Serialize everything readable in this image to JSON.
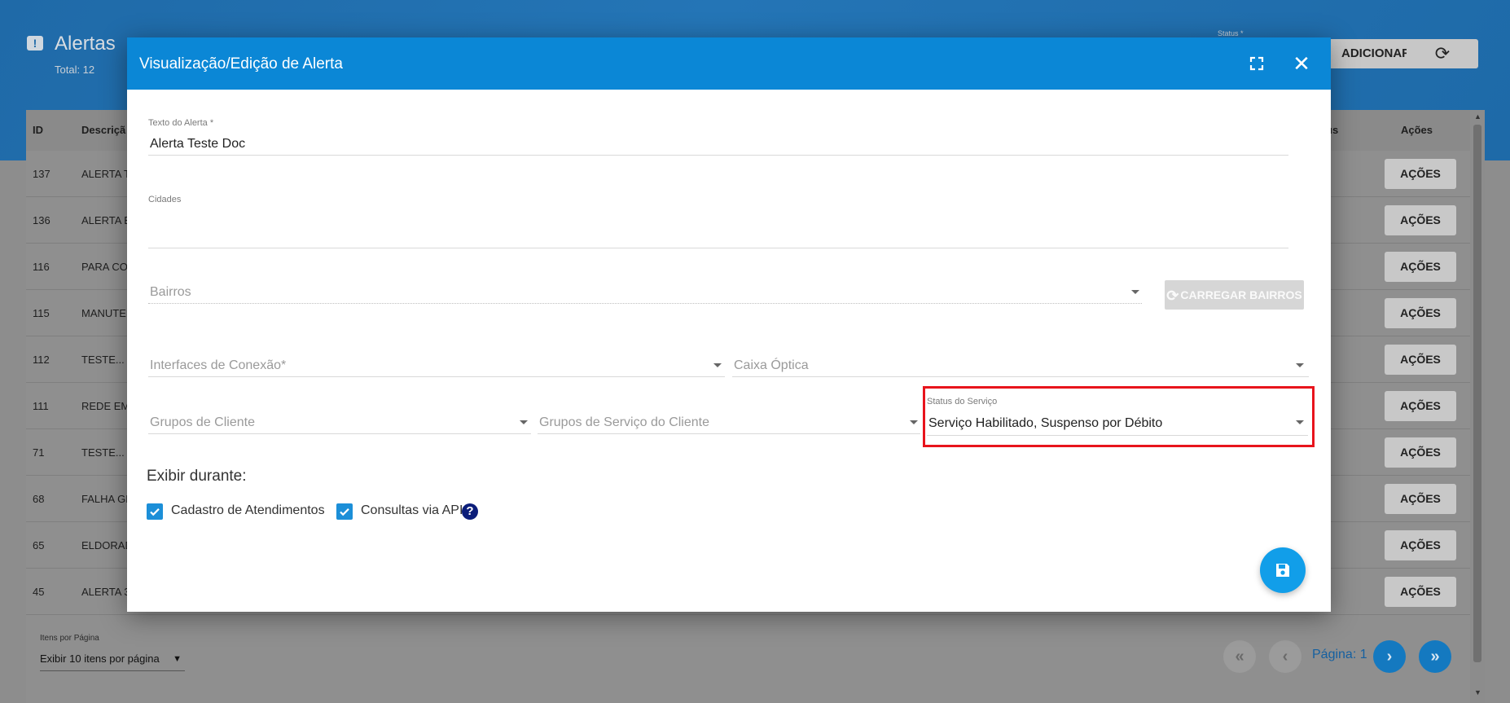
{
  "page": {
    "title": "Alertas",
    "total": "Total: 12",
    "status_mini_label": "Status *",
    "add_button": "ADICIONAR",
    "refresh_icon": "refresh-icon"
  },
  "table": {
    "headers": {
      "id": "ID",
      "description": "Descriçã",
      "status": "us",
      "actions": "Ações"
    },
    "rows": [
      {
        "id": "137",
        "desc": "ALERTA T",
        "action": "AÇÕES"
      },
      {
        "id": "136",
        "desc": "ALERTA B",
        "action": "AÇÕES"
      },
      {
        "id": "116",
        "desc": "PARA CON",
        "action": "AÇÕES"
      },
      {
        "id": "115",
        "desc": "MANUTEN",
        "action": "AÇÕES"
      },
      {
        "id": "112",
        "desc": "TESTE...",
        "action": "AÇÕES"
      },
      {
        "id": "111",
        "desc": "REDE EM",
        "action": "AÇÕES"
      },
      {
        "id": "71",
        "desc": "TESTE...",
        "action": "AÇÕES"
      },
      {
        "id": "68",
        "desc": "FALHA GE",
        "action": "AÇÕES"
      },
      {
        "id": "65",
        "desc": "ELDORAD",
        "action": "AÇÕES"
      },
      {
        "id": "45",
        "desc": "ALERTA 3",
        "action": "AÇÕES"
      }
    ]
  },
  "pagination": {
    "per_page_label": "Itens por Página",
    "per_page_value": "Exibir 10 itens por página",
    "page_label": "Página: 1"
  },
  "modal": {
    "title": "Visualização/Edição de Alerta",
    "texto_label": "Texto do Alerta *",
    "texto_value": "Alerta Teste Doc",
    "cidades_label": "Cidades",
    "bairros_placeholder": "Bairros",
    "carregar_bairros": "CARREGAR BAIRROS",
    "interfaces_placeholder": "Interfaces de Conexão*",
    "caixa_placeholder": "Caixa Óptica",
    "grupos_cliente_placeholder": "Grupos de Cliente",
    "grupos_servico_placeholder": "Grupos de Serviço do Cliente",
    "status_servico_label": "Status do Serviço",
    "status_servico_value": "Serviço Habilitado, Suspenso por Débito",
    "exibir_durante": "Exibir durante:",
    "check_cadastro": "Cadastro de Atendimentos",
    "check_api": "Consultas via API",
    "cadastro_checked": true,
    "api_checked": true
  },
  "colors": {
    "header_blue": "#0b87d6",
    "fab_blue": "#119ee9",
    "highlight_red": "#e8141c",
    "checkbox_blue": "#1c8fd8"
  }
}
